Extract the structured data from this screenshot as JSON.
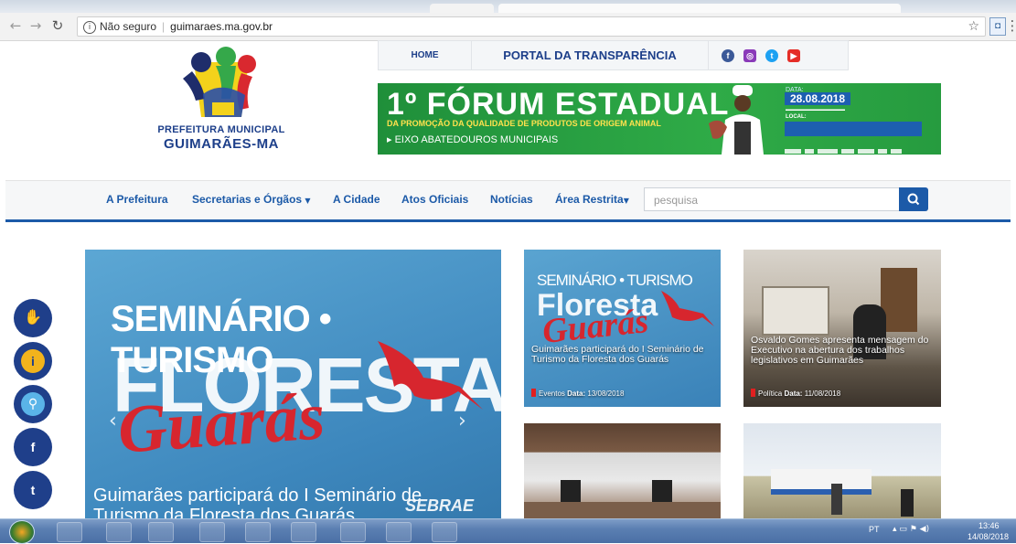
{
  "browser": {
    "security_label": "Não seguro",
    "url": "guimaraes.ma.gov.br"
  },
  "site": {
    "logo": {
      "line1": "PREFEITURA MUNICIPAL",
      "line2": "GUIMARÃES-MA"
    },
    "topbar": {
      "home": "HOME",
      "portal": "PORTAL DA TRANSPARÊNCIA"
    },
    "social": [
      "facebook-icon",
      "instagram-icon",
      "twitter-icon",
      "youtube-icon"
    ],
    "banner": {
      "title": "1º FÓRUM ESTADUAL",
      "subtitle": "DA PROMOÇÃO DA QUALIDADE DE PRODUTOS DE ORIGEM ANIMAL",
      "eixo": "▸ EIXO ABATEDOUROS MUNICIPAIS",
      "date_label": "DATA:",
      "date": "28.08.2018",
      "local_label": "LOCAL:"
    },
    "nav": {
      "items": [
        "A Prefeitura",
        "Secretarias e Órgãos",
        "A Cidade",
        "Atos Oficiais",
        "Notícias",
        "Área Restrita"
      ],
      "search_placeholder": "pesquisa"
    },
    "slider": {
      "art_line1": "SEMINÁRIO • TURISMO",
      "art_line2": "FLORESTA",
      "art_line3": "Guarás",
      "caption": "Guimarães participará do I Seminário de Turismo da Floresta dos Guarás",
      "sebrae": "SEBRAE"
    },
    "cards": [
      {
        "caption": "Guimarães participará do I Seminário de Turismo da Floresta dos Guarás",
        "category": "Eventos",
        "date_label": "Data:",
        "date": "13/08/2018",
        "art_line1": "SEMINÁRIO • TURISMO",
        "art_line2": "Floresta",
        "art_line3": "Guarás"
      },
      {
        "caption": "Osvaldo Gomes apresenta mensagem do Executivo na abertura dos trabalhos legislativos em Guimarães",
        "category": "Política",
        "date_label": "Data:",
        "date": "11/08/2018"
      }
    ],
    "floating": [
      "accessibility-icon",
      "info-icon",
      "search-icon",
      "facebook-icon",
      "twitter-icon"
    ]
  },
  "taskbar": {
    "lang": "PT",
    "time": "13:46",
    "date": "14/08/2018"
  }
}
